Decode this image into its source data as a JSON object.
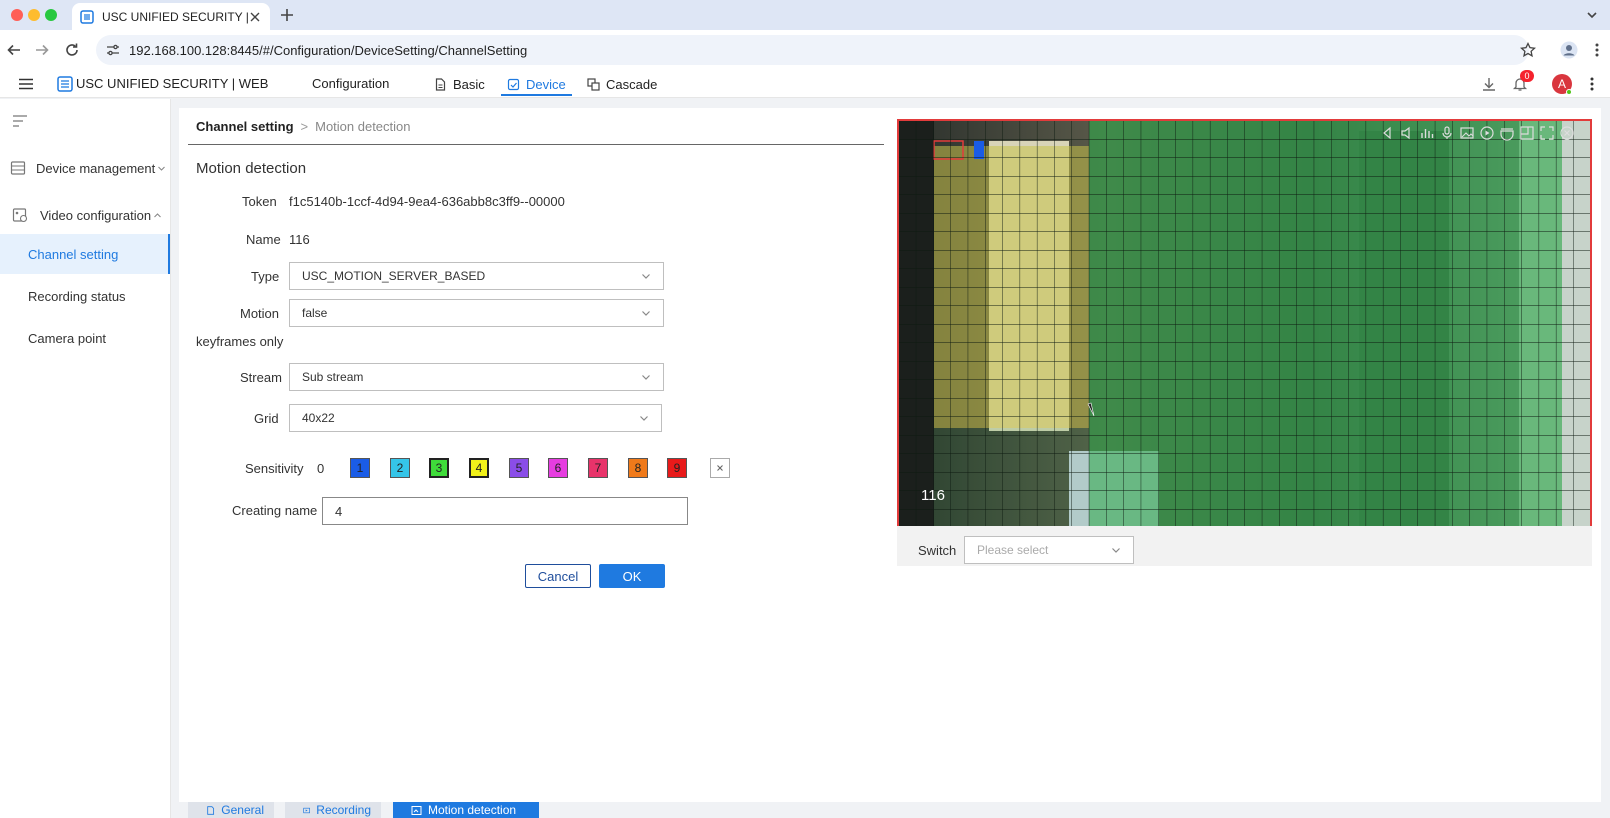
{
  "browser": {
    "tab_title": "USC UNIFIED SECURITY | WE",
    "url": "192.168.100.128:8445/#/Configuration/DeviceSetting/ChannelSetting"
  },
  "header": {
    "app_title": "USC UNIFIED SECURITY | WEB",
    "section": "Configuration",
    "nav": [
      "Basic",
      "Device",
      "Cascade"
    ],
    "active_nav": "Device",
    "notification_count": "0",
    "avatar_initial": "A"
  },
  "sidebar": {
    "groups": [
      "Device management",
      "Video configuration"
    ],
    "items": [
      "Channel setting",
      "Recording status",
      "Camera point"
    ],
    "active_item": "Channel setting"
  },
  "breadcrumb": {
    "parent": "Channel setting",
    "separator": ">",
    "current": "Motion detection"
  },
  "form": {
    "title": "Motion detection",
    "token_label": "Token",
    "token_value": "f1c5140b-1ccf-4d94-9ea4-636abb8c3ff9--00000",
    "name_label": "Name",
    "name_value": "116",
    "type_label": "Type",
    "type_value": "USC_MOTION_SERVER_BASED",
    "motion_label_1": "Motion",
    "motion_label_2": "keyframes only",
    "motion_value": "false",
    "stream_label": "Stream",
    "stream_value": "Sub stream",
    "grid_label": "Grid",
    "grid_value": "40x22",
    "sensitivity_label": "Sensitivity",
    "sensitivity_levels": [
      "0",
      "1",
      "2",
      "3",
      "4",
      "5",
      "6",
      "7",
      "8",
      "9"
    ],
    "sensitivity_colors": [
      "#ffffff",
      "#1a5ce6",
      "#35c5e8",
      "#3fdc3a",
      "#f2f21a",
      "#8a4de8",
      "#e63de0",
      "#e8336a",
      "#f07a1a",
      "#e81a1a"
    ],
    "selected_sensitivity": "4",
    "creating_name_label": "Creating name",
    "creating_name_value": "4",
    "cancel_label": "Cancel",
    "ok_label": "OK"
  },
  "preview": {
    "channel_label": "116",
    "switch_label": "Switch",
    "switch_placeholder": "Please select",
    "toolbar_icons": [
      "prev-icon",
      "audio-icon",
      "stats-icon",
      "mic-icon",
      "snapshot-icon",
      "play-icon",
      "ptz-icon",
      "layout-icon",
      "fullscreen-icon",
      "close-icon"
    ]
  },
  "bottom_tabs": [
    "General",
    "Recording",
    "Motion detection"
  ],
  "active_bottom_tab": "Motion detection",
  "colors": {
    "accent": "#1f7ae0",
    "motion_overlay": "#2ea84b",
    "selection_overlay": "#c9c24a",
    "preview_border": "#e23b3b"
  }
}
